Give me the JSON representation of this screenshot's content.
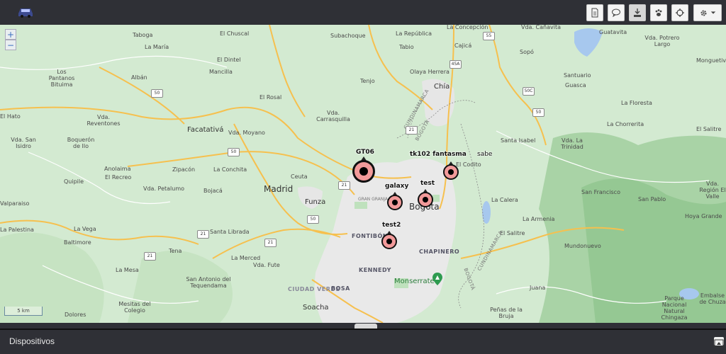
{
  "header": {
    "logo_icon": "car-logo-icon",
    "toolbar": [
      {
        "name": "report-button",
        "icon": "document-icon"
      },
      {
        "name": "chat-button",
        "icon": "chat-bubble-icon"
      },
      {
        "name": "download-button",
        "icon": "download-icon",
        "active": true
      },
      {
        "name": "paw-button",
        "icon": "paw-icon"
      },
      {
        "name": "locate-button",
        "icon": "crosshair-icon"
      },
      {
        "name": "settings-button",
        "icon": "gear-icon"
      }
    ]
  },
  "map": {
    "zoom_in": "+",
    "zoom_out": "−",
    "scale_label": "5 km",
    "places": [
      "Taboga",
      "El Chuscal",
      "Subachoque",
      "La República",
      "La Concepción",
      "Vda. Cañavita",
      "Guatavita",
      "Vda. Potrero Largo",
      "La María",
      "Tabio",
      "Cajicá",
      "Sopó",
      "Los Pantanos Bituima",
      "El Dintel",
      "Olaya Herrera",
      "Monguetiv",
      "Albán",
      "Mancilla",
      "Tenjo",
      "Chía",
      "Santuario",
      "Guasca",
      "El Rosal",
      "La Floresta",
      "El Hato",
      "Vda. Carrasquilla",
      "Vda. Reventones",
      "Facatativá",
      "Vda. Moyano",
      "La Chorrerita",
      "Vda. San Isidro",
      "Boquerón de Ilo",
      "Santa Isabel",
      "Vda. La Trinidad",
      "El Salitre",
      "El Codito",
      "Anolaima",
      "El Recreo",
      "Zipacón",
      "La Conchita",
      "Ceuta",
      "Quipile",
      "Vda. Petalumo",
      "Bojacá",
      "Madrid",
      "Funza",
      "Bogota",
      "San Francisco",
      "Vda. Región El Valle",
      "Valparaiso",
      "San Pablo",
      "La Calera",
      "La Palestina",
      "La Vega",
      "Santa Librada",
      "FONTIBÓN",
      "La Armenia",
      "Hoya Grande",
      "Baltimore",
      "El Salitre",
      "Mundonuevo",
      "Tena",
      "CHAPINERO",
      "La Mesa",
      "La Merced",
      "Vda. Fute",
      "KENNEDY",
      "San Antonio del Tequendama",
      "Monserrate",
      "Juana",
      "Mesitas del Colegio",
      "CIUDAD VERDE",
      "BOSA",
      "Dolores",
      "Soacha",
      "Peñas de la Bruja",
      "Parque Nacional Natural Chingaza",
      "Embalse de Chuza",
      "GRAN GRANJA"
    ],
    "road_shields": [
      "55",
      "50",
      "45A",
      "50C",
      "21",
      "50",
      "21",
      "21",
      "50",
      "21",
      "50",
      "21"
    ],
    "road_names": [
      "CUNDINAMARCA",
      "BOGOTÁ",
      "CUNDINAMARCA",
      "BOGOTÁ"
    ]
  },
  "devices": [
    {
      "label": "GT06",
      "selected": true
    },
    {
      "label": "tk102 fantasma",
      "suffix": "sabe"
    },
    {
      "label": "galaxy"
    },
    {
      "label": "test"
    },
    {
      "label": "test2"
    }
  ],
  "bottom_panel": {
    "title": "Dispositivos",
    "expand_icon": "expand-panel-icon"
  }
}
